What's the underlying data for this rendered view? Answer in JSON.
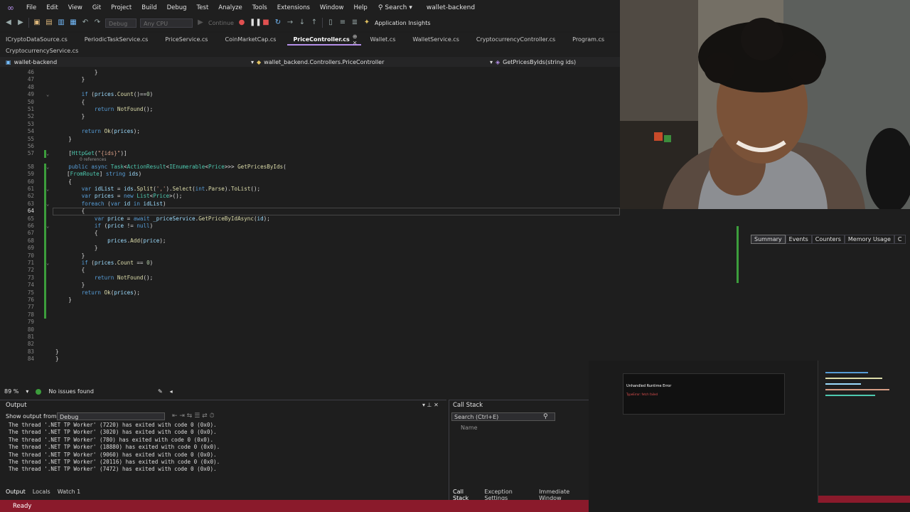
{
  "menu": {
    "items": [
      "File",
      "Edit",
      "View",
      "Git",
      "Project",
      "Build",
      "Debug",
      "Test",
      "Analyze",
      "Tools",
      "Extensions",
      "Window",
      "Help"
    ],
    "search_label": "Search",
    "solution_name": "wallet-backend"
  },
  "toolbar": {
    "config": "Debug",
    "platform": "Any CPU",
    "continue_label": "Continue",
    "insights_label": "Application Insights"
  },
  "tabs_row1": [
    "ICryptoDataSource.cs",
    "PeriodicTaskService.cs",
    "PriceService.cs",
    "CoinMarketCap.cs",
    "PriceController.cs",
    "Wallet.cs",
    "WalletService.cs",
    "CryptocurrencyController.cs",
    "Program.cs",
    "Bi"
  ],
  "tabs_row2": [
    "CryptocurrencyService.cs"
  ],
  "active_tab": "PriceController.cs",
  "navbar": {
    "project": "wallet-backend",
    "class": "wallet_backend.Controllers.PriceController",
    "member": "GetPricesByIds(string ids)"
  },
  "code_lines": [
    {
      "n": "46",
      "h": "            }"
    },
    {
      "n": "47",
      "h": "        }"
    },
    {
      "n": "48",
      "h": ""
    },
    {
      "n": "49",
      "h": "        <span class=\"kw\">if</span> (<span class=\"va\">prices</span>.<span class=\"me\">Count</span>()==<span class=\"nu\">0</span>)"
    },
    {
      "n": "50",
      "h": "        {"
    },
    {
      "n": "51",
      "h": "            <span class=\"kw\">return</span> <span class=\"me\">NotFound</span>();"
    },
    {
      "n": "52",
      "h": "        }"
    },
    {
      "n": "53",
      "h": ""
    },
    {
      "n": "54",
      "h": "        <span class=\"kw\">return</span> <span class=\"me\">Ok</span>(<span class=\"va\">prices</span>);"
    },
    {
      "n": "55",
      "h": "    }"
    },
    {
      "n": "56",
      "h": ""
    },
    {
      "n": "57",
      "h": "    [<span class=\"at\">HttpGet</span>(<span class=\"st\">\"{ids}\"</span>)]"
    },
    {
      "n": "58",
      "h": "    <span class=\"kw\">public</span> <span class=\"kw\">async</span> <span class=\"ty\">Task</span>&lt;<span class=\"ty\">ActionResult</span>&lt;<span class=\"ty\">IEnumerable</span>&lt;<span class=\"ty\">Price</span>&gt;&gt;&gt; <span class=\"me\">GetPricesByIds</span>("
    },
    {
      "n": "59",
      "h": "[<span class=\"at\">FromRoute</span>] <span class=\"kw\">string</span> <span class=\"va\">ids</span>)"
    },
    {
      "n": "60",
      "h": "    {"
    },
    {
      "n": "61",
      "h": "        <span class=\"kw\">var</span> <span class=\"va\">idList</span> = <span class=\"va\">ids</span>.<span class=\"me\">Split</span>(<span class=\"st\">','</span>).<span class=\"me\">Select</span>(<span class=\"kw\">int</span>.<span class=\"me\">Parse</span>).<span class=\"me\">ToList</span>();"
    },
    {
      "n": "62",
      "h": "        <span class=\"kw\">var</span> <span class=\"va\">prices</span> = <span class=\"kw\">new</span> <span class=\"ty\">List</span>&lt;<span class=\"ty\">Price</span>&gt;();"
    },
    {
      "n": "63",
      "h": "        <span class=\"kw\">foreach</span> (<span class=\"kw\">var</span> <span class=\"va\">id</span> <span class=\"kw\">in</span> <span class=\"va\">idList</span>)"
    },
    {
      "n": "64",
      "h": "        {"
    },
    {
      "n": "65",
      "h": "            <span class=\"kw\">var</span> <span class=\"va\">price</span> = <span class=\"kw\">await</span> <span class=\"va\">_priceService</span>.<span class=\"me\">GetPriceByIdAsync</span>(<span class=\"va\">id</span>);"
    },
    {
      "n": "66",
      "h": "            <span class=\"kw\">if</span> (<span class=\"va\">price</span> != <span class=\"kw\">null</span>)"
    },
    {
      "n": "67",
      "h": "            {"
    },
    {
      "n": "68",
      "h": "                <span class=\"va\">prices</span>.<span class=\"me\">Add</span>(<span class=\"va\">price</span>);"
    },
    {
      "n": "69",
      "h": "            }"
    },
    {
      "n": "70",
      "h": "        }"
    },
    {
      "n": "71",
      "h": "        <span class=\"kw\">if</span> (<span class=\"va\">prices</span>.<span class=\"me\">Count</span> == <span class=\"nu\">0</span>)"
    },
    {
      "n": "72",
      "h": "        {"
    },
    {
      "n": "73",
      "h": "            <span class=\"kw\">return</span> <span class=\"me\">NotFound</span>();"
    },
    {
      "n": "74",
      "h": "        }"
    },
    {
      "n": "75",
      "h": "        <span class=\"kw\">return</span> <span class=\"me\">Ok</span>(<span class=\"va\">prices</span>);"
    },
    {
      "n": "76",
      "h": "    }"
    },
    {
      "n": "77",
      "h": ""
    },
    {
      "n": "78",
      "h": ""
    },
    {
      "n": "79",
      "h": ""
    },
    {
      "n": "80",
      "h": ""
    },
    {
      "n": "81",
      "h": ""
    },
    {
      "n": "82",
      "h": ""
    },
    {
      "n": "83",
      "h": "}"
    },
    {
      "n": "84",
      "h": "}"
    }
  ],
  "code_refs": "0 references",
  "editor_status": {
    "zoom": "89 %",
    "issues": "No issues found"
  },
  "output": {
    "title": "Output",
    "show_from_label": "Show output from:",
    "show_from_value": "Debug",
    "lines": [
      "The thread '.NET TP Worker' (7220) has exited with code 0 (0x0).",
      "The thread '.NET TP Worker' (3020) has exited with code 0 (0x0).",
      "The thread '.NET TP Worker' (780) has exited with code 0 (0x0).",
      "The thread '.NET TP Worker' (18880) has exited with code 0 (0x0).",
      "The thread '.NET TP Worker' (9060) has exited with code 0 (0x0).",
      "The thread '.NET TP Worker' (20116) has exited with code 0 (0x0).",
      "The thread '.NET TP Worker' (7472) has exited with code 0 (0x0)."
    ],
    "bottom_tabs": [
      "Output",
      "Locals",
      "Watch 1"
    ]
  },
  "callstack": {
    "title": "Call Stack",
    "search_placeholder": "Search (Ctrl+E)",
    "column": "Name",
    "bottom_tabs": [
      "Call Stack",
      "Exception Settings",
      "Immediate Window"
    ]
  },
  "status": {
    "text": "Ready"
  },
  "diagnostics": {
    "tabs": [
      "Summary",
      "Events",
      "Counters",
      "Memory Usage",
      "C"
    ]
  },
  "thumbnail": {
    "title": "Unhandled Runtime Error",
    "message": "TypeError: fetch failed"
  },
  "colors": {
    "status_bar": "#8a1a2b",
    "accent": "#b48ee8",
    "change_marker": "#3c9d3c"
  }
}
